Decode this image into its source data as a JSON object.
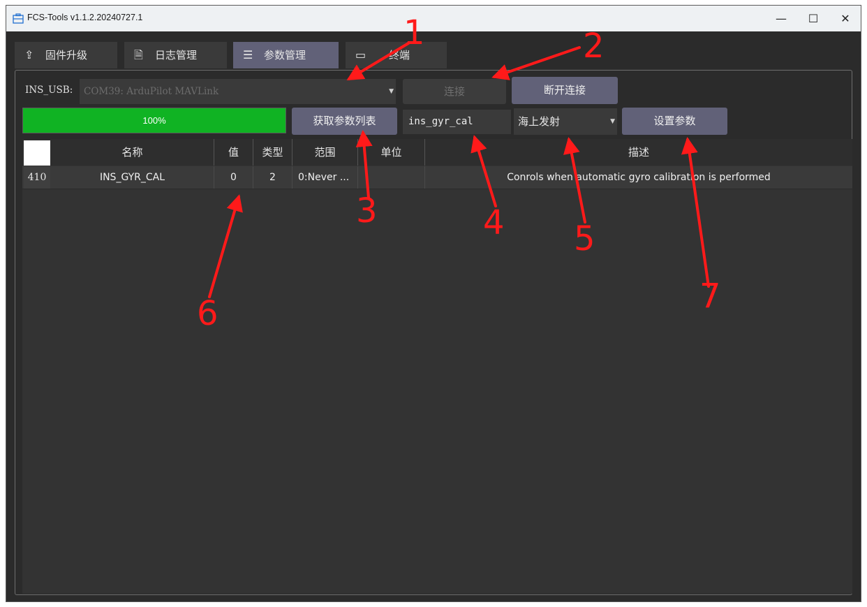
{
  "window": {
    "title": "FCS-Tools v1.1.2.20240727.1",
    "min_glyph": "—",
    "max_glyph": "☐",
    "close_glyph": "✕"
  },
  "tabs": [
    {
      "icon": "⇪",
      "label": "固件升级",
      "active": false
    },
    {
      "icon": "🗎",
      "label": "日志管理",
      "active": false
    },
    {
      "icon": "☰",
      "label": "参数管理",
      "active": true
    },
    {
      "icon": "▭",
      "label": "终端",
      "active": false
    }
  ],
  "connection": {
    "serial_label": "INS_USB:",
    "port_value": "COM39: ArduPilot MAVLink",
    "connect_label": "连接",
    "disconnect_label": "断开连接"
  },
  "params": {
    "progress_text": "100%",
    "progress_value": 1.0,
    "fetch_label": "获取参数列表",
    "search_value": "ins_gyr_cal",
    "value_select": "海上发射",
    "set_label": "设置参数"
  },
  "table": {
    "headers": [
      "名称",
      "值",
      "类型",
      "范围",
      "单位",
      "描述"
    ],
    "rows": [
      {
        "index": "410",
        "name": "INS_GYR_CAL",
        "value": "0",
        "type": "2",
        "range": "0:Never ...",
        "unit": "",
        "desc": "Conrols when automatic gyro calibration is performed"
      }
    ]
  },
  "annotations": [
    "1",
    "2",
    "3",
    "4",
    "5",
    "6",
    "7"
  ],
  "colors": {
    "accent": "#616178",
    "progress": "#10b323",
    "annotation": "#ff1a1a"
  }
}
